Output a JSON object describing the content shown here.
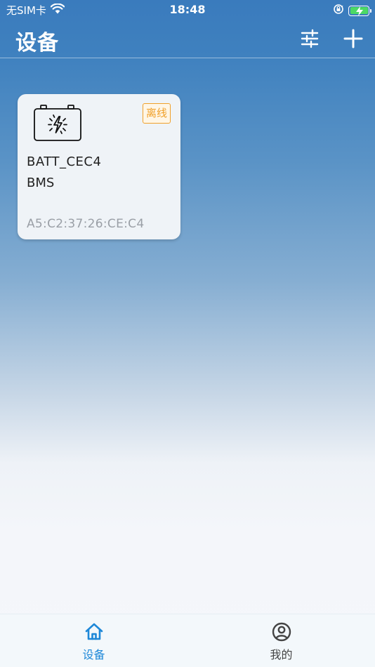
{
  "status_bar": {
    "carrier": "无SIM卡",
    "time": "18:48"
  },
  "header": {
    "title": "设备",
    "filter_icon": "sliders-icon",
    "add_icon": "plus-icon"
  },
  "devices": [
    {
      "icon": "battery-icon",
      "status": "离线",
      "name": "BATT_CEC4",
      "type": "BMS",
      "mac": "A5:C2:37:26:CE:C4"
    }
  ],
  "tabs": [
    {
      "label": "设备",
      "icon": "home-icon",
      "active": true
    },
    {
      "label": "我的",
      "icon": "user-circle-icon",
      "active": false
    }
  ],
  "colors": {
    "accent": "#1e88d8",
    "offline_badge": "#f0a02a",
    "header_blue": "#3a7bbd"
  }
}
